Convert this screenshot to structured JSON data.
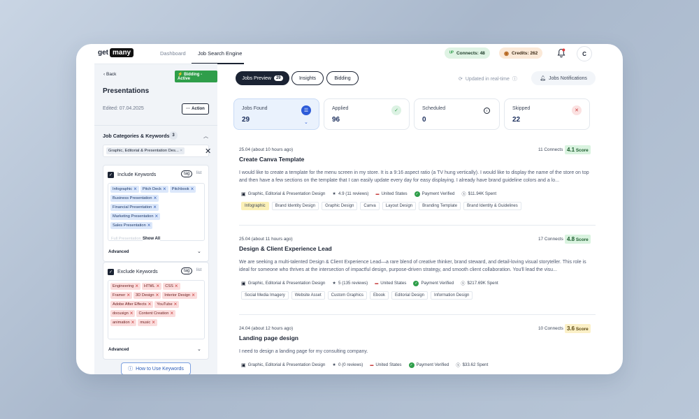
{
  "topbar": {
    "logo_a": "get",
    "logo_b": "many",
    "tabs": [
      "Dashboard",
      "Job Search Engine"
    ],
    "connects": "Connects: 48",
    "credits": "Credits: 262",
    "avatar": "C"
  },
  "left": {
    "back": "Back",
    "status": "Bidding - Active",
    "title": "Presentations",
    "edited": "Edited: 07.04.2025",
    "action": "Action",
    "categories_title": "Job Categories & Keywords",
    "categories_count": "3",
    "category_chip": "Graphic, Editorial & Presentation Des...",
    "include": {
      "title": "Include Keywords",
      "tag": "tag",
      "list": "list",
      "keywords": [
        "Infographic",
        "Pitch Deck",
        "Pitchbook",
        "Business Presentation",
        "Financial Presentation",
        "Marketing Presentation",
        "Sales Presentation"
      ],
      "faded": "Full Presentation",
      "show_all": "Show All",
      "advanced": "Advanced"
    },
    "exclude": {
      "title": "Exclude Keywords",
      "tag": "tag",
      "list": "list",
      "keywords": [
        "Engineering",
        "HTML",
        "CSS",
        "Framer",
        "3D Design",
        "Interior Design",
        "Adobe After Effects",
        "YouTube",
        "docusign",
        "Content Creation",
        "animation",
        "music"
      ],
      "advanced": "Advanced"
    },
    "howto": "How to Use Keywords"
  },
  "main": {
    "tabs": {
      "preview": "Jobs Preview",
      "preview_count": "29",
      "insights": "Insights",
      "bidding": "Bidding"
    },
    "updated": "Updated in real-time",
    "notifications": "Jobs Notifications",
    "stats": [
      {
        "label": "Jobs Found",
        "value": "29"
      },
      {
        "label": "Applied",
        "value": "96"
      },
      {
        "label": "Scheduled",
        "value": "0"
      },
      {
        "label": "Skipped",
        "value": "22"
      }
    ],
    "jobs": [
      {
        "date": "25.04 (about 10 hours ago)",
        "connects": "11 Connects",
        "score": "4.1",
        "score_label": "Score",
        "title": "Create Canva Template",
        "desc": "I would like to create a template for the menu screen in my store. It is a 9:16 aspect ratio (a TV hung vertically). I would like to display the name of the store on top and then have a few sections on the template that I can easily update every day for easy displaying. I already have brand guideline colors and a lo...",
        "category": "Graphic, Editorial & Presentation Design",
        "rating": "4.9 (11 reviews)",
        "country": "United States",
        "verified": "Payment Verified",
        "spent": "$11.94K Spent",
        "tags": [
          "Infographic",
          "Brand Identity Design",
          "Graphic Design",
          "Canva",
          "Layout Design",
          "Branding Template",
          "Brand Identity & Guidelines"
        ]
      },
      {
        "date": "25.04 (about 11 hours ago)",
        "connects": "17 Connects",
        "score": "4.8",
        "score_label": "Score",
        "title": "Design & Client Experience Lead",
        "desc": "We are seeking a multi-talented Design & Client Experience Lead—a rare blend of creative thinker, brand steward, and detail-loving visual storyteller. This role is ideal for someone who thrives at the intersection of impactful design, purpose-driven strategy, and smooth client collaboration. You'll lead the visu...",
        "category": "Graphic, Editorial & Presentation Design",
        "rating": "5 (135 reviews)",
        "country": "United States",
        "verified": "Payment Verified",
        "spent": "$217.69K Spent",
        "tags": [
          "Social Media Imagery",
          "Website Asset",
          "Custom Graphics",
          "Ebook",
          "Editorial Design",
          "Information Design"
        ]
      },
      {
        "date": "24.04 (about 12 hours ago)",
        "connects": "10 Connects",
        "score": "3.6",
        "score_label": "Score",
        "title": "Landing page design",
        "desc": "I need to design a landing page for my consulting company.",
        "category": "Graphic, Editorial & Presentation Design",
        "rating": "0 (0 reviews)",
        "country": "United States",
        "verified": "Payment Verified",
        "spent": "$33.62 Spent"
      }
    ]
  }
}
